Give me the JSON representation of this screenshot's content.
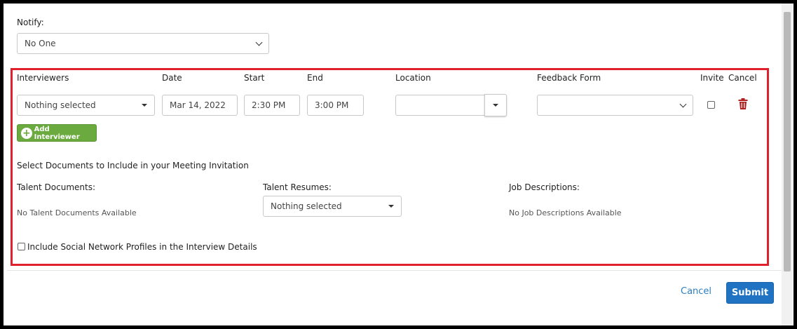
{
  "notify": {
    "label": "Notify:",
    "selected": "No One"
  },
  "table": {
    "headers": {
      "interviewers": "Interviewers",
      "date": "Date",
      "start": "Start",
      "end": "End",
      "location": "Location",
      "feedback_form": "Feedback Form",
      "invite": "Invite",
      "cancel": "Cancel"
    },
    "row": {
      "interviewers_selected": "Nothing selected",
      "date": "Mar 14, 2022",
      "start": "2:30 PM",
      "end": "3:00 PM",
      "location": "",
      "feedback_form": "",
      "invite_checked": false
    }
  },
  "add_interviewer_label": "Add Interviewer",
  "documents": {
    "heading": "Select Documents to Include in your Meeting Invitation",
    "talent_documents_label": "Talent Documents:",
    "talent_documents_empty": "No Talent Documents Available",
    "talent_resumes_label": "Talent Resumes:",
    "talent_resumes_selected": "Nothing selected",
    "job_descriptions_label": "Job Descriptions:",
    "job_descriptions_empty": "No Job Descriptions Available"
  },
  "social_profiles_label": "Include Social Network Profiles in the Interview Details",
  "footer": {
    "cancel_label": "Cancel",
    "submit_label": "Submit"
  },
  "colors": {
    "highlight_border": "#e0202a",
    "add_button": "#6aaa3e",
    "submit_button": "#1f73c2",
    "link": "#2d7fc1",
    "trash_icon": "#b01e1e"
  },
  "icons": {
    "add": "plus-circle-icon",
    "delete": "trash-icon",
    "dropdown": "chevron-down-icon",
    "caret": "caret-down-icon"
  }
}
